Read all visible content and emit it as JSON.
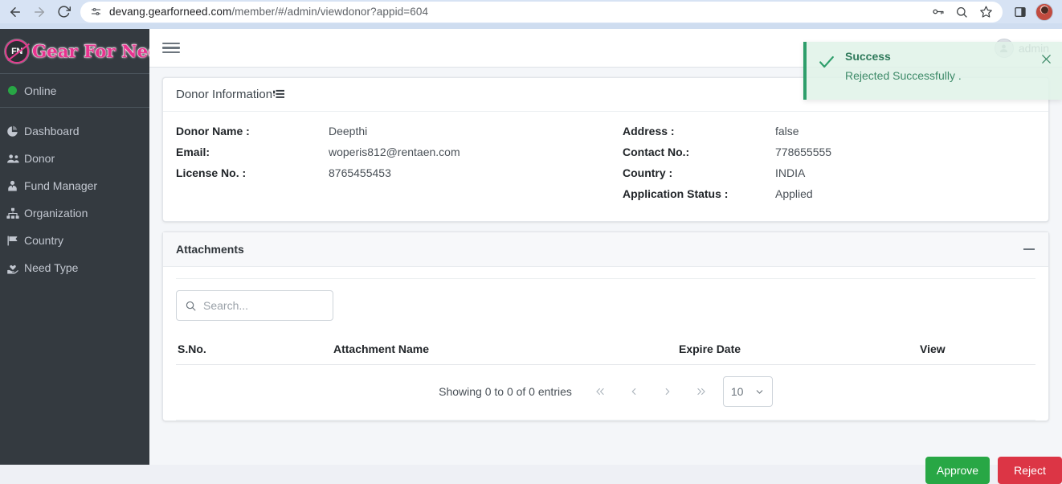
{
  "browser": {
    "url_prefix": "devang.gearforneed.com",
    "url_path": "/member/#/admin/viewdonor?appid=604",
    "back_icon": "back-arrow-icon",
    "forward_icon": "forward-arrow-icon",
    "reload_icon": "reload-icon",
    "site_info_icon": "site-settings-icon",
    "password_icon": "password-key-icon",
    "zoom_icon": "search-magnifier-icon",
    "bookmark_icon": "star-icon",
    "sidepanel_icon": "side-panel-icon",
    "profile_icon": "profile-avatar-icon"
  },
  "sidebar": {
    "brand": {
      "badge_text": "FN",
      "name": "Gear For Need"
    },
    "status": {
      "label": "Online",
      "dot_color": "#28a745"
    },
    "items": [
      {
        "label": "Dashboard",
        "icon": "pie-chart-icon"
      },
      {
        "label": "Donor",
        "icon": "users-icon"
      },
      {
        "label": "Fund Manager",
        "icon": "user-tie-icon"
      },
      {
        "label": "Organization",
        "icon": "sitemap-icon"
      },
      {
        "label": "Country",
        "icon": "flag-icon"
      },
      {
        "label": "Need Type",
        "icon": "hand-heart-icon"
      }
    ]
  },
  "topbar": {
    "menu_icon": "hamburger-menu-icon",
    "user_name": "admin",
    "user_icon": "user-circle-icon"
  },
  "toast": {
    "title": "Success",
    "message": "Rejected Successfully .",
    "check_icon": "check-icon",
    "close_icon": "close-icon",
    "accent_color": "#2e9e6b"
  },
  "donor_card": {
    "title": "Donor Information",
    "title_icon": "list-detail-icon",
    "fields_left": [
      {
        "label": "Donor Name :",
        "value": "Deepthi"
      },
      {
        "label": "Email:",
        "value": "woperis812@rentaen.com"
      },
      {
        "label": "License No. :",
        "value": "8765455453"
      }
    ],
    "fields_right": [
      {
        "label": "Address :",
        "value": "false"
      },
      {
        "label": "Contact No.:",
        "value": "778655555"
      },
      {
        "label": "Country :",
        "value": "INDIA"
      },
      {
        "label": "Application Status :",
        "value": "Applied"
      }
    ]
  },
  "attachments": {
    "title": "Attachments",
    "collapse_icon": "minimize-icon",
    "search": {
      "placeholder": "Search...",
      "value": "",
      "icon": "search-icon"
    },
    "columns": [
      "S.No.",
      "Attachment Name",
      "Expire Date",
      "View"
    ],
    "rows": [],
    "pagination": {
      "info": "Showing 0 to 0 of 0 entries",
      "first_icon": "double-chevron-left-icon",
      "prev_icon": "chevron-left-icon",
      "next_icon": "chevron-right-icon",
      "last_icon": "double-chevron-right-icon",
      "page_size": "10",
      "page_size_caret": "chevron-down-icon"
    }
  },
  "actions": {
    "approve_label": "Approve",
    "reject_label": "Reject",
    "approve_color": "#28a745",
    "reject_color": "#dc3545"
  }
}
